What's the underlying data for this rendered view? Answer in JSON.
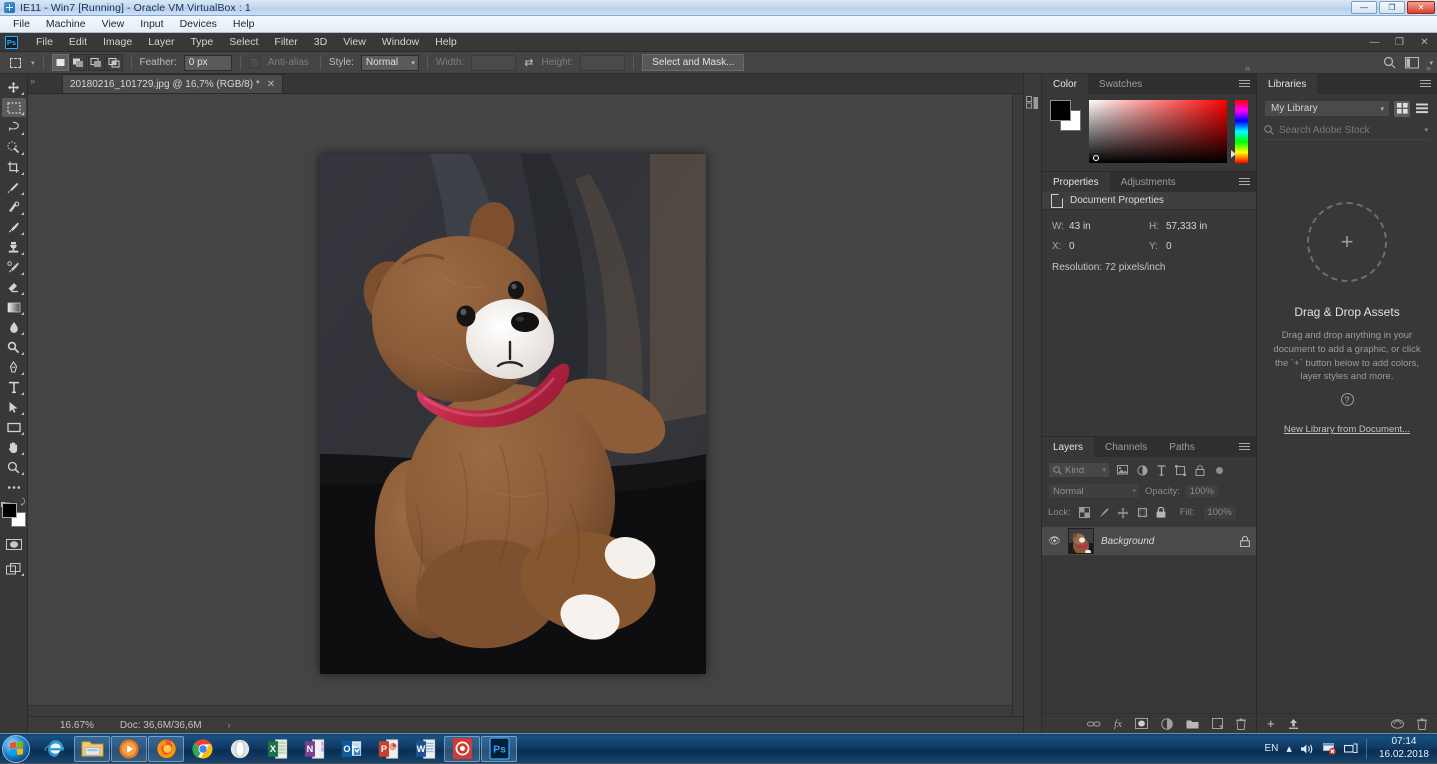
{
  "vbox": {
    "title": "IE11 - Win7 [Running] - Oracle VM VirtualBox : 1",
    "icon": "virtualbox-icon",
    "menu": [
      "File",
      "Machine",
      "View",
      "Input",
      "Devices",
      "Help"
    ],
    "window_buttons": {
      "minimize": "—",
      "restore": "❐",
      "close": "✕"
    }
  },
  "photoshop": {
    "logo": "Ps",
    "menu": [
      "File",
      "Edit",
      "Image",
      "Layer",
      "Type",
      "Select",
      "Filter",
      "3D",
      "View",
      "Window",
      "Help"
    ],
    "window_buttons": {
      "minimize": "—",
      "restore": "❐",
      "close": "✕"
    },
    "options_bar": {
      "tool": "rectangular-marquee-tool",
      "selection_modes": [
        "new-selection",
        "add-to-selection",
        "subtract-from-selection",
        "intersect-with-selection"
      ],
      "feather_label": "Feather:",
      "feather_value": "0 px",
      "antialias_label": "Anti-alias",
      "style_label": "Style:",
      "style_value": "Normal",
      "width_label": "Width:",
      "width_value": "",
      "height_label": "Height:",
      "height_value": "",
      "select_and_mask": "Select and Mask...",
      "search_icon": "search-icon",
      "workspace_icon": "workspace-switcher-icon"
    },
    "toolbar": [
      "move-tool",
      "rectangular-marquee-tool",
      "lasso-tool",
      "quick-selection-tool",
      "crop-tool",
      "eyedropper-tool",
      "spot-healing-brush-tool",
      "brush-tool",
      "clone-stamp-tool",
      "history-brush-tool",
      "eraser-tool",
      "gradient-tool",
      "blur-tool",
      "dodge-tool",
      "pen-tool",
      "horizontal-type-tool",
      "path-selection-tool",
      "rectangle-tool",
      "hand-tool",
      "zoom-tool",
      "edit-toolbar-tool"
    ],
    "toolbar_extras": {
      "foreground_color": "#000000",
      "background_color": "#ffffff",
      "quick_mask": "quick-mask-mode",
      "screen_mode": "screen-mode"
    },
    "document": {
      "tab_label": "20180216_101729.jpg @ 16,7% (RGB/8) *",
      "tab_close": "✕",
      "image_alt": "brown teddy bear with red scarf sitting on dark plaid fabric"
    },
    "statusbar": {
      "zoom": "16.67%",
      "doc_info": "Doc: 36,6M/36,6M",
      "arrow": "›"
    }
  },
  "panels": {
    "color": {
      "tabs": [
        {
          "label": "Color",
          "active": true
        },
        {
          "label": "Swatches",
          "active": false
        }
      ],
      "menu_icon": "panel-menu-icon",
      "foreground": "#000000",
      "background": "#ffffff",
      "field_base_hue": "#ff0000"
    },
    "properties": {
      "tabs": [
        {
          "label": "Properties",
          "active": true
        },
        {
          "label": "Adjustments",
          "active": false
        }
      ],
      "menu_icon": "panel-menu-icon",
      "header_title": "Document Properties",
      "header_icon": "document-icon",
      "fields": [
        {
          "key": "W:",
          "value": "43 in"
        },
        {
          "key": "H:",
          "value": "57,333 in"
        },
        {
          "key": "X:",
          "value": "0"
        },
        {
          "key": "Y:",
          "value": "0"
        }
      ],
      "resolution": "Resolution: 72 pixels/inch"
    },
    "layers": {
      "tabs": [
        {
          "label": "Layers",
          "active": true
        },
        {
          "label": "Channels",
          "active": false
        },
        {
          "label": "Paths",
          "active": false
        }
      ],
      "menu_icon": "panel-menu-icon",
      "filter_kind": "Kind",
      "filter_icons": [
        "filter-pixel-icon",
        "filter-adjustment-icon",
        "filter-type-icon",
        "filter-shape-icon",
        "filter-smart-object-icon"
      ],
      "blend_mode": "Normal",
      "opacity_label": "Opacity:",
      "opacity_value": "100%",
      "lock_label": "Lock:",
      "lock_icons": [
        "lock-transparent-pixels-icon",
        "lock-image-pixels-icon",
        "lock-position-icon",
        "lock-artboard-icon",
        "lock-all-icon"
      ],
      "fill_label": "Fill:",
      "fill_value": "100%",
      "rows": [
        {
          "visible": true,
          "eye_icon": "eye-icon",
          "name": "Background",
          "lock_icon": "lock-icon"
        }
      ],
      "footer_icons": [
        "link-layers-icon",
        "layer-style-fx-icon",
        "add-layer-mask-icon",
        "new-adjustment-layer-icon",
        "new-group-icon",
        "new-layer-icon",
        "delete-layer-icon"
      ]
    },
    "libraries": {
      "tabs": [
        {
          "label": "Libraries",
          "active": true
        }
      ],
      "menu_icon": "panel-menu-icon",
      "library_select": "My Library",
      "view_icons": [
        "grid-view-icon",
        "list-view-icon"
      ],
      "search_placeholder": "Search Adobe Stock",
      "search_icon": "search-icon",
      "empty_title": "Drag & Drop Assets",
      "empty_description": "Drag and drop anything in your document to add a graphic, or click the `+` button below to add colors, layer styles and more.",
      "help_icon": "help-icon",
      "link": "New Library from Document...",
      "footer_icons": [
        "add-asset-icon",
        "upload-icon",
        "sync-icon",
        "delete-icon"
      ]
    }
  },
  "taskbar": {
    "start": "start-orb",
    "items": [
      {
        "name": "internet-explorer-icon",
        "label": "Internet Explorer",
        "pinned": false
      },
      {
        "name": "windows-explorer-icon",
        "label": "Windows Explorer",
        "pinned": true
      },
      {
        "name": "windows-media-player-icon",
        "label": "Windows Media Player",
        "pinned": true
      },
      {
        "name": "firefox-icon",
        "label": "Mozilla Firefox",
        "pinned": true
      },
      {
        "name": "chrome-icon",
        "label": "Google Chrome",
        "pinned": false
      },
      {
        "name": "opera-icon",
        "label": "Opera",
        "pinned": false
      },
      {
        "name": "excel-icon",
        "label": "Microsoft Excel",
        "pinned": false
      },
      {
        "name": "onenote-icon",
        "label": "Microsoft OneNote",
        "pinned": false
      },
      {
        "name": "outlook-icon",
        "label": "Microsoft Outlook",
        "pinned": false
      },
      {
        "name": "powerpoint-icon",
        "label": "Microsoft PowerPoint",
        "pinned": false
      },
      {
        "name": "word-icon",
        "label": "Microsoft Word",
        "pinned": false
      },
      {
        "name": "recording-app-icon",
        "label": "Recorder",
        "pinned": true
      },
      {
        "name": "photoshop-icon",
        "label": "Adobe Photoshop",
        "pinned": true
      }
    ],
    "tray": {
      "language": "EN",
      "show_hidden_icon": "chevron-up-icon",
      "volume_icon": "speaker-icon",
      "action_center_icon": "flag-warning-icon",
      "network_icon": "network-icon",
      "time": "07:14",
      "date": "16.02.2018"
    }
  }
}
